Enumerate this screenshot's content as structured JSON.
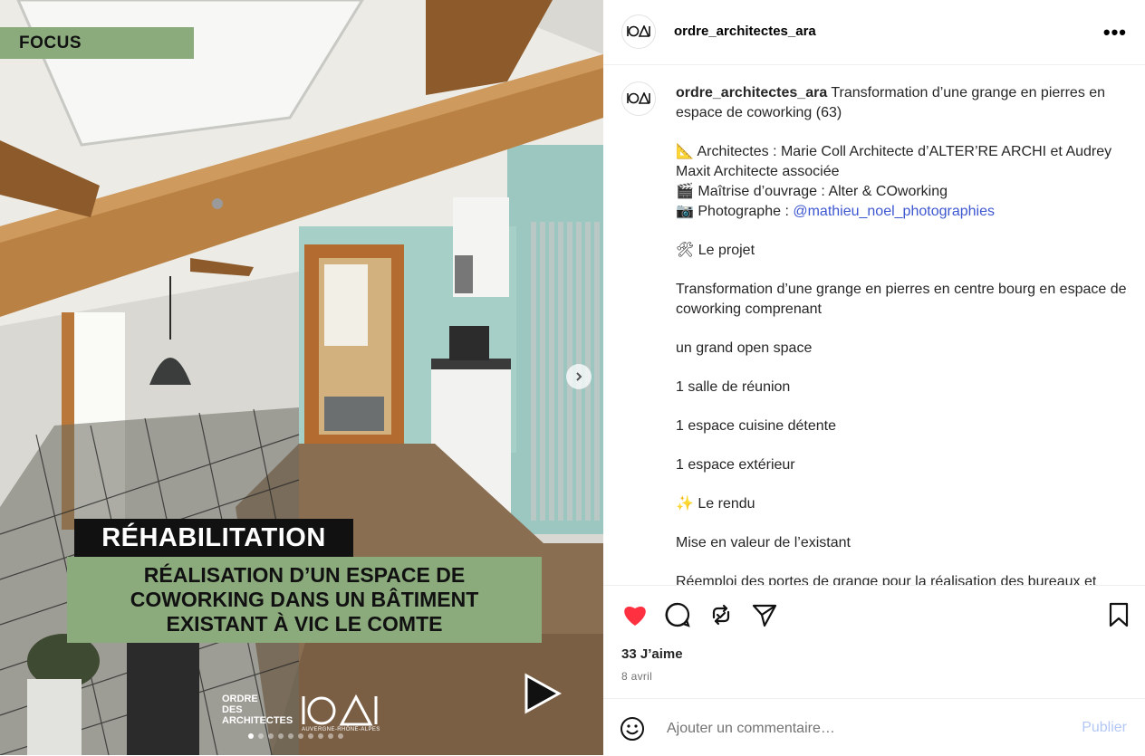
{
  "post": {
    "tag": "FOCUS",
    "overlay_title": "RÉHABILITATION",
    "overlay_lines": [
      "RÉALISATION D’UN ESPACE DE",
      "COWORKING DANS UN BÂTIMENT",
      "EXISTANT À VIC LE COMTE"
    ],
    "logo_lines": [
      "ORDRE",
      "DES",
      "ARCHITECTES"
    ],
    "logo_sub": "AUVERGNE-RHÔNE-ALPES",
    "carousel_count": 10,
    "carousel_active": 1
  },
  "header": {
    "username": "ordre_architectes_ara",
    "more_label": "•••"
  },
  "caption": {
    "username": "ordre_architectes_ara",
    "title": "Transformation d’une grange en pierres en espace de coworking (63)",
    "architectes": "📐 Architectes : Marie Coll Architecte d’ALTER’RE ARCHI et Audrey Maxit Architecte associée",
    "maitrise": "🎬 Maîtrise d’ouvrage : Alter & COworking",
    "photographe_prefix": "📷  Photographe : ",
    "photographe_mention": "@mathieu_noel_photographies",
    "projet_heading": "🛠 Le projet",
    "projet_text": "Transformation d’une grange en pierres en centre bourg en espace de coworking comprenant",
    "item1": "un grand open space",
    "item2": "1 salle de réunion",
    "item3": "1 espace cuisine détente",
    "item4": "1 espace extérieur",
    "rendu_heading": "✨  Le rendu",
    "rendu_text": "Mise en valeur de l’existant",
    "reemploi_text": "Réemploi des portes de grange pour la réalisation des bureaux et"
  },
  "stats": {
    "likes": "33 J’aime",
    "date": "8 avril"
  },
  "comment": {
    "placeholder": "Ajouter un commentaire…",
    "publish_label": "Publier"
  },
  "colors": {
    "accent_green": "#8bab7d",
    "like_red": "#ff3040",
    "link_blue": "#3d57d1",
    "publish_disabled": "#b3c7f5"
  }
}
